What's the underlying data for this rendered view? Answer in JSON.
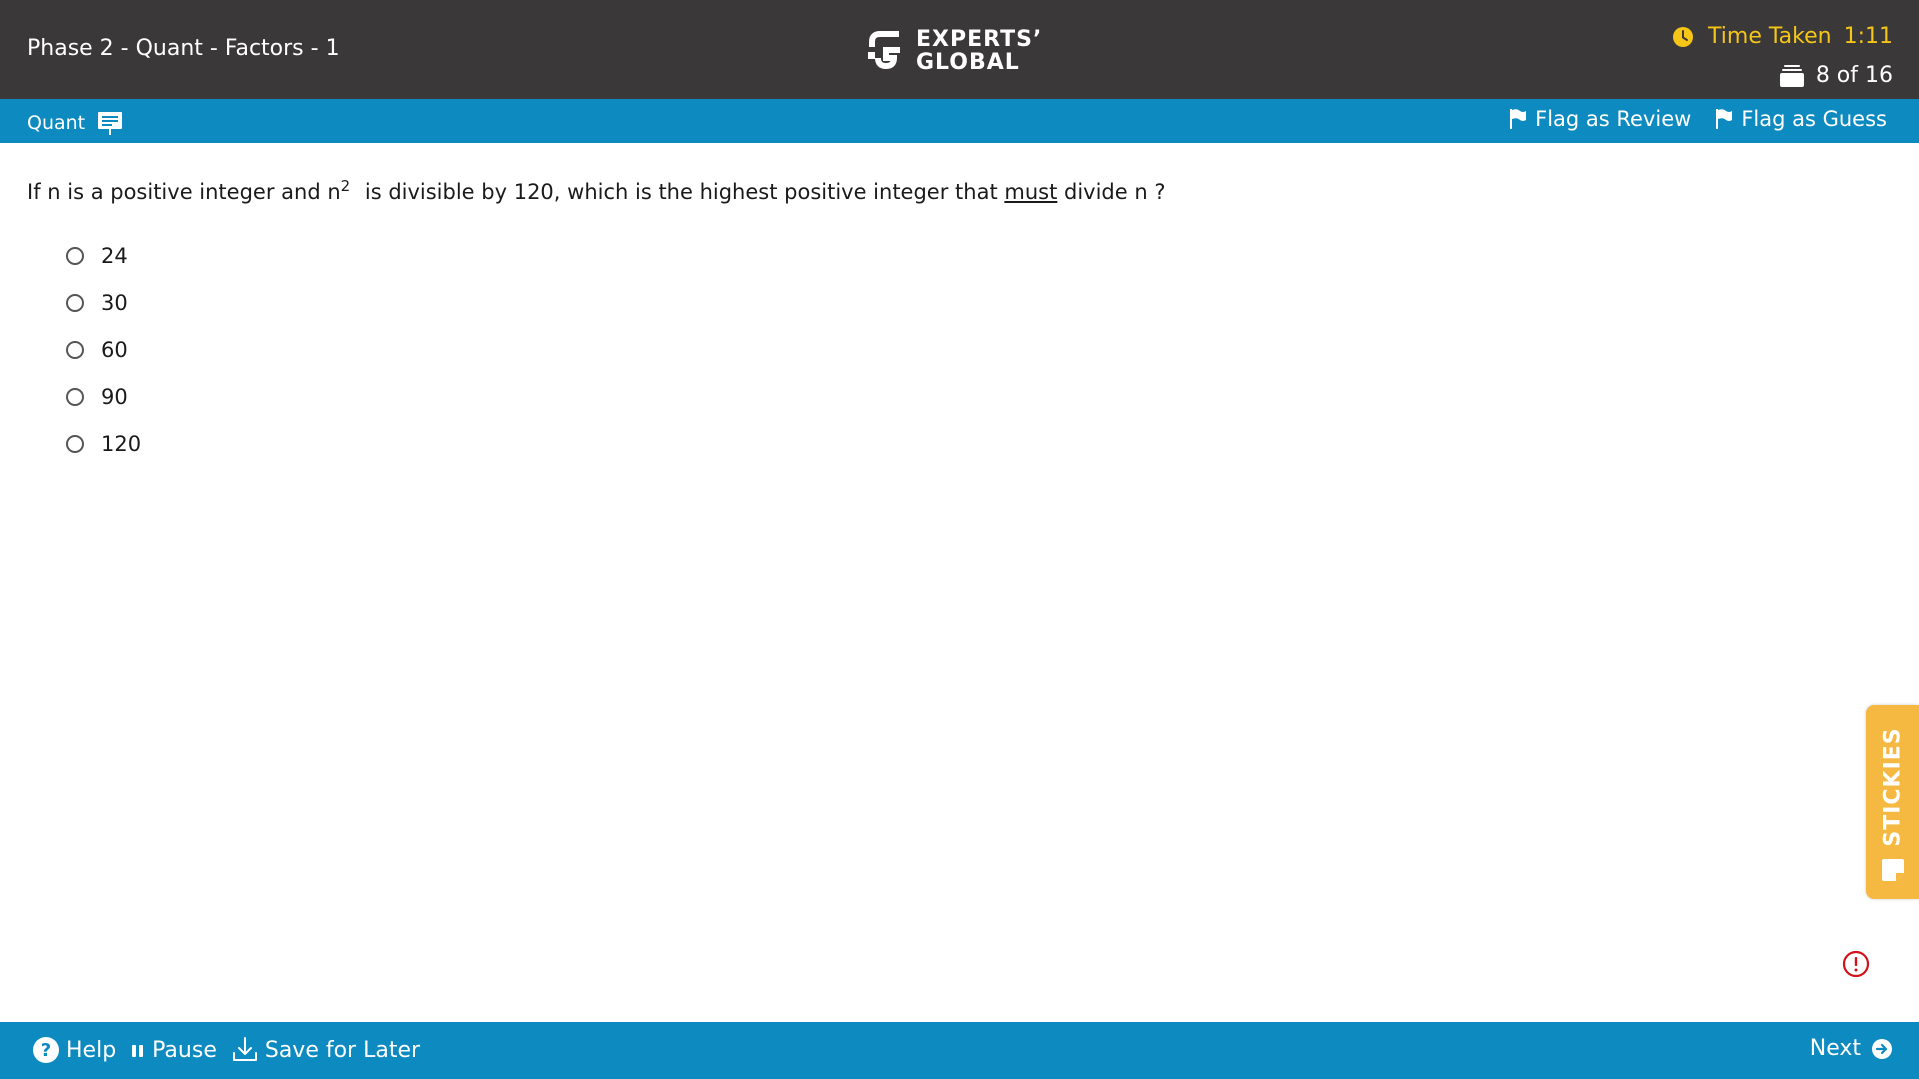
{
  "header": {
    "test_title": "Phase 2 - Quant - Factors - 1",
    "logo_line1": "EXPERTS’",
    "logo_line2": "GLOBAL",
    "timer_label": "Time Taken",
    "timer_value": "1:11",
    "progress": "8 of 16",
    "timer_color": "#f5c518",
    "bg_color": "#3a3838"
  },
  "section_bar": {
    "section_name": "Quant",
    "flag_review_label": "Flag as Review",
    "flag_guess_label": "Flag as Guess",
    "bg_color": "#0d8ac0"
  },
  "question": {
    "text_part1": "If n is a positive integer and n",
    "superscript": "2",
    "text_part2": " is divisible by 120, which is the highest positive integer that ",
    "emphasis": "must",
    "text_part3": " divide n ?",
    "options": [
      {
        "label": "24",
        "selected": false
      },
      {
        "label": "30",
        "selected": false
      },
      {
        "label": "60",
        "selected": false
      },
      {
        "label": "90",
        "selected": false
      },
      {
        "label": "120",
        "selected": false
      }
    ]
  },
  "stickies": {
    "label": "STICKIES",
    "color": "#f5b841"
  },
  "footer": {
    "help_label": "Help",
    "pause_label": "Pause",
    "save_label": "Save for Later",
    "next_label": "Next"
  },
  "icons": {
    "clock": "clock-icon",
    "progress": "question-stack-icon",
    "section": "whiteboard-icon",
    "flag": "flag-icon",
    "report": "report-alert-icon",
    "help": "help-icon",
    "pause": "pause-icon",
    "save": "download-icon",
    "next": "arrow-right-circle-icon",
    "note": "sticky-note-icon"
  }
}
